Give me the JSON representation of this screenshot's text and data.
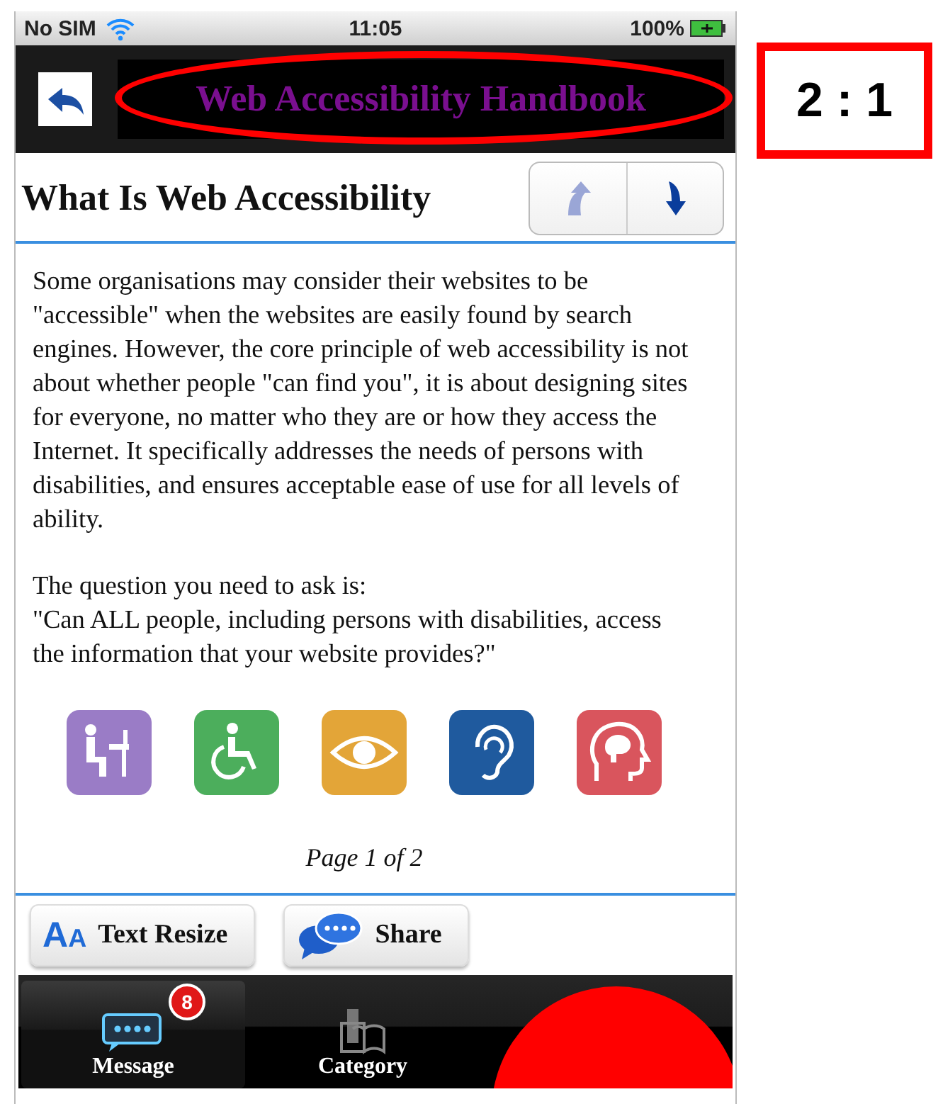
{
  "status_bar": {
    "carrier": "No SIM",
    "time": "11:05",
    "battery": "100%"
  },
  "header": {
    "title": "Web Accessibility Handbook"
  },
  "page": {
    "title": "What Is Web Accessibility",
    "nav_buttons": [
      {
        "kind": "up",
        "disabled": true
      },
      {
        "kind": "down",
        "disabled": false
      }
    ],
    "paragraphs": [
      "Some organisations may consider their websites to be \"accessible\" when the websites are easily found by search engines. However, the core principle of web accessibility is not about whether people \"can find you\", it is about designing sites for everyone, no matter who they are or how they access the Internet. It specifically addresses the needs of persons with disabilities, and ensures acceptable ease of use for all levels of ability.",
      "The question you need to ask is:",
      "\"Can ALL people, including persons with disabilities, access the information that your website provides?\""
    ],
    "pagination": "Page 1 of 2"
  },
  "actions": [
    {
      "kind": "resize",
      "label": "Text Resize",
      "icon_text": "AA"
    },
    {
      "kind": "share",
      "label": "Share"
    }
  ],
  "tabs": [
    {
      "kind": "message",
      "label": "Message",
      "selected": true,
      "badge": "8"
    },
    {
      "kind": "category",
      "label": "Category",
      "selected": false
    }
  ],
  "annotation": {
    "ratio": "2 : 1"
  }
}
